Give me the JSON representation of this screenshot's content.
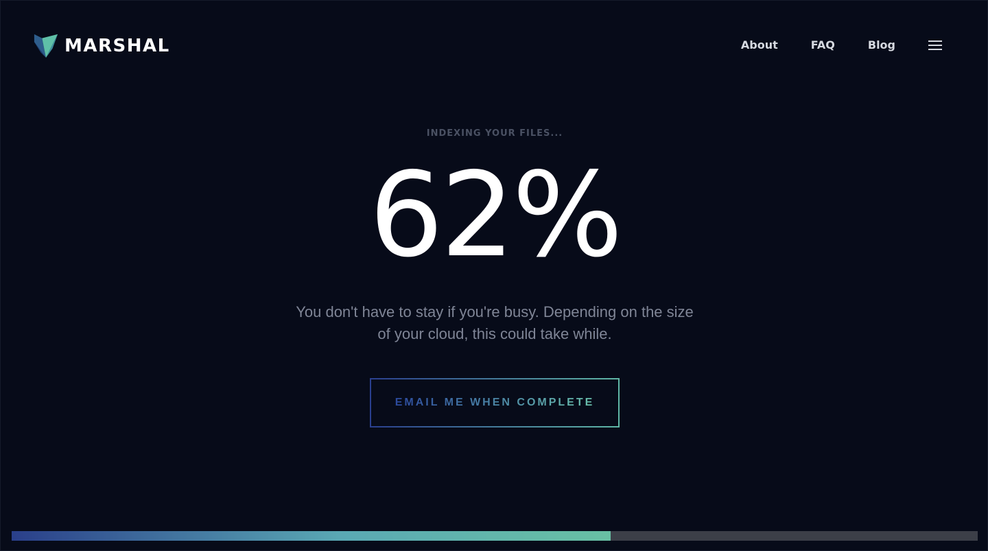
{
  "brand": {
    "name": "MARSHAL",
    "logo_icon": "marshal-shield-logo"
  },
  "nav": {
    "items": [
      {
        "label": "About"
      },
      {
        "label": "FAQ"
      },
      {
        "label": "Blog"
      }
    ],
    "menu_icon": "hamburger-menu-icon"
  },
  "status": {
    "eyebrow": "INDEXING YOUR FILES...",
    "percent_text": "62%",
    "progress_fraction": 0.62,
    "description": "You don't have to stay if you're busy. Depending on the size of your cloud, this could take while."
  },
  "cta": {
    "label": "EMAIL ME WHEN COMPLETE"
  },
  "colors": {
    "background": "#070b19",
    "accent_start": "#2a3f8f",
    "accent_end": "#5fb7a6",
    "progress_track": "#3c3f48"
  }
}
